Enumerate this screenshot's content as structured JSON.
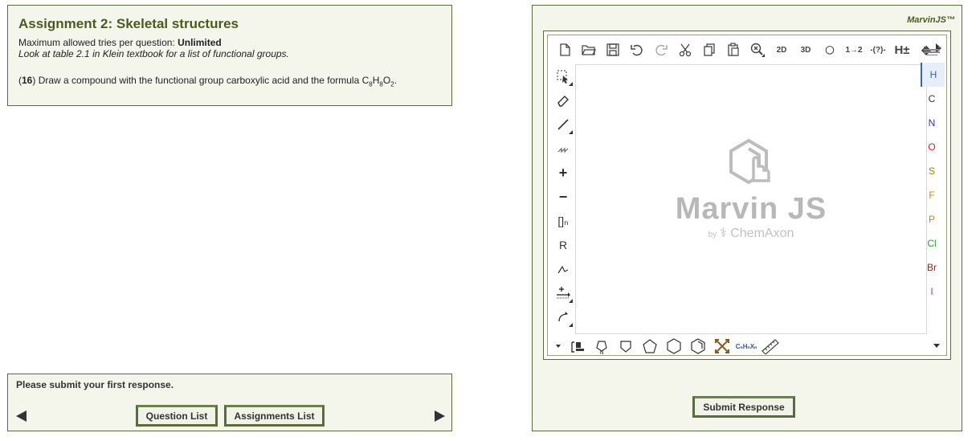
{
  "assignment": {
    "title": "Assignment 2: Skeletal structures",
    "tries_label": "Maximum allowed tries per question: ",
    "tries_value": "Unlimited",
    "hint": "Look at table 2.1 in Klein textbook for a list of functional groups.",
    "question_number": "16",
    "question_text": " Draw a compound with the functional group carboxylic acid and the formula C",
    "formula": {
      "c_count": "8",
      "h": "H",
      "h_count": "8",
      "o": "O",
      "o_count": "2"
    },
    "period": "."
  },
  "submission": {
    "status_text": "Please submit your first response.",
    "question_list_label": "Question List",
    "assignments_list_label": "Assignments List"
  },
  "marvin": {
    "label": "MarvinJS™",
    "logo_title": "Marvin JS",
    "logo_by": "by",
    "logo_company": "ChemAxon",
    "top_tools": [
      "new-document",
      "open",
      "save",
      "undo",
      "redo",
      "cut",
      "copy",
      "paste",
      "zoom",
      "clean-2d",
      "clean-3d",
      "3d-view",
      "reaction-numbering",
      "query",
      "add-hydrogens",
      "stereo"
    ],
    "left_tools": [
      "select",
      "erase",
      "bond",
      "chain",
      "charge-plus",
      "charge-minus",
      "bracket",
      "r-group",
      "reaction-arrow",
      "plus-arrow",
      "attach"
    ],
    "left_labels": {
      "bracket": "[]ₙ",
      "rgroup": "R"
    },
    "elements": [
      {
        "symbol": "H",
        "color": "#3a64b0",
        "selected": true
      },
      {
        "symbol": "C",
        "color": "#333333",
        "selected": false
      },
      {
        "symbol": "N",
        "color": "#3333cc",
        "selected": false
      },
      {
        "symbol": "O",
        "color": "#dd2222",
        "selected": false
      },
      {
        "symbol": "S",
        "color": "#8a8a00",
        "selected": false
      },
      {
        "symbol": "F",
        "color": "#cc8800",
        "selected": false
      },
      {
        "symbol": "P",
        "color": "#cc8800",
        "selected": false
      },
      {
        "symbol": "Cl",
        "color": "#22aa22",
        "selected": false
      },
      {
        "symbol": "Br",
        "color": "#992222",
        "selected": false
      },
      {
        "symbol": "I",
        "color": "#aa33aa",
        "selected": false
      }
    ],
    "submit_label": "Submit Response"
  }
}
